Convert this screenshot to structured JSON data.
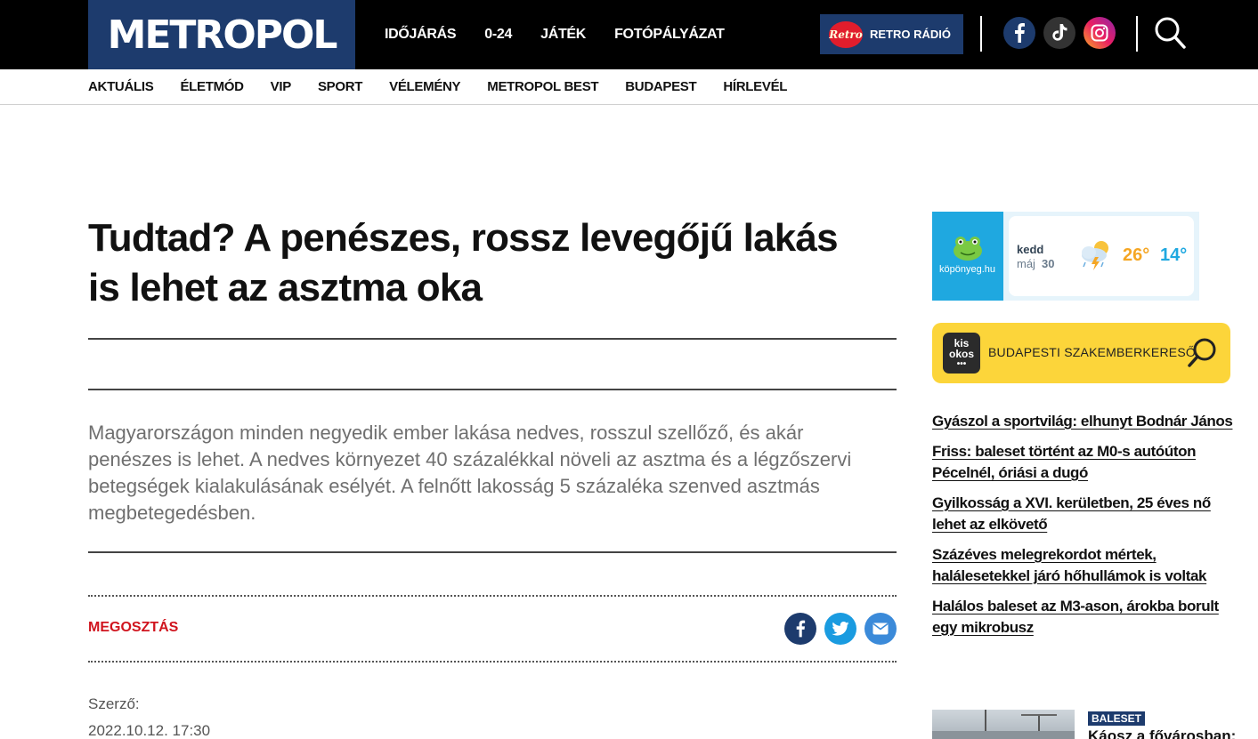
{
  "header": {
    "logo": "METROPOL",
    "nav": [
      "IDŐJÁRÁS",
      "0-24",
      "JÁTÉK",
      "FOTÓPÁLYÁZAT"
    ],
    "retro_radio": "RETRO RÁDIÓ",
    "retro_logo": "Retro"
  },
  "secondary_nav": [
    "AKTUÁLIS",
    "ÉLETMÓD",
    "VIP",
    "SPORT",
    "VÉLEMÉNY",
    "METROPOL BEST",
    "BUDAPEST",
    "HÍRLEVÉL"
  ],
  "article": {
    "title": "Tudtad? A penészes, rossz levegőjű lakás is lehet az asztma oka",
    "lead": "Magyarországon minden negyedik ember lakása nedves, rosszul szellőző, és akár penészes is lehet. A nedves környezet 40 százalékkal növeli az asztma és a légzőszervi betegségek kialakulásának esélyét. A felnőtt lakosság 5 százaléka szenved asztmás megbetegedésben.",
    "share_label": "MEGOSZTÁS",
    "author_label": "Szerző:",
    "date": "2022.10.12. 17:30"
  },
  "weather": {
    "brand": "köpönyeg.hu",
    "day": "kedd",
    "date_prefix": "máj",
    "date_day": "30",
    "high": "26°",
    "low": "14°"
  },
  "kisokos": {
    "logo_line1": "kis",
    "logo_line2": "okos",
    "text": "BUDAPESTI SZAKEMBERKERESŐ"
  },
  "news": [
    "Gyászol a sportvilág: elhunyt Bodnár János",
    "Friss: baleset történt az M0-s autóúton Pécelnél, óriási a dugó",
    "Gyilkosság a XVI. kerületben, 25 éves nő lehet az elkövető",
    "Százéves melegrekordot mértek, halálesetekkel járó hőhullámok is voltak",
    "Halálos baleset az M3-ason, árokba borult egy mikrobusz"
  ],
  "featured": {
    "badge": "BALESET",
    "title": "Káosz a fővárosban:"
  }
}
